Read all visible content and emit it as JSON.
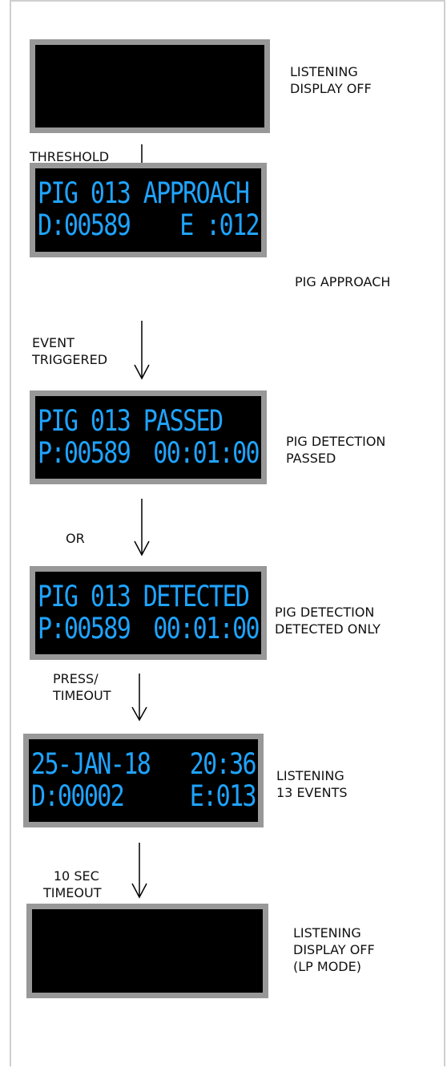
{
  "states": [
    {
      "id": "off1",
      "screen": {
        "line1": [
          "",
          ""
        ],
        "line2": [
          "",
          ""
        ]
      },
      "label": [
        "LISTENING",
        "DISPLAY OFF"
      ]
    },
    {
      "id": "approach",
      "screen": {
        "line1": [
          "PIG 013 APPROACH",
          ""
        ],
        "line2": [
          "D:00589",
          "E :012"
        ]
      },
      "label": [
        "PIG APPROACH"
      ]
    },
    {
      "id": "passed",
      "screen": {
        "line1": [
          "PIG 013 PASSED",
          ""
        ],
        "line2": [
          "P:00589",
          "00:01:00"
        ]
      },
      "label": [
        "PIG DETECTION",
        "PASSED"
      ]
    },
    {
      "id": "detected",
      "screen": {
        "line1": [
          "PIG 013 DETECTED",
          ""
        ],
        "line2": [
          "P:00589",
          "00:01:00"
        ]
      },
      "label": [
        "PIG DETECTION",
        "DETECTED ONLY"
      ]
    },
    {
      "id": "listening",
      "screen": {
        "line1": [
          "25-JAN-18",
          "20:36"
        ],
        "line2": [
          "D:00002",
          "E:013"
        ]
      },
      "label": [
        "LISTENING",
        "13 EVENTS"
      ]
    },
    {
      "id": "off2",
      "screen": {
        "line1": [
          "",
          ""
        ],
        "line2": [
          "",
          ""
        ]
      },
      "label": [
        "LISTENING",
        "DISPLAY OFF",
        "(LP MODE)"
      ]
    }
  ],
  "transitions": [
    {
      "label": "THRESHOLD"
    },
    {
      "label": "EVENT\nTRIGGERED"
    },
    {
      "label": "OR"
    },
    {
      "label": "PRESS/\nTIMEOUT"
    },
    {
      "label": "10 SEC\nTIMEOUT"
    }
  ],
  "colors": {
    "bezel": "#989898",
    "screen": "#000000",
    "lcd_text": "#1fa4ff"
  }
}
